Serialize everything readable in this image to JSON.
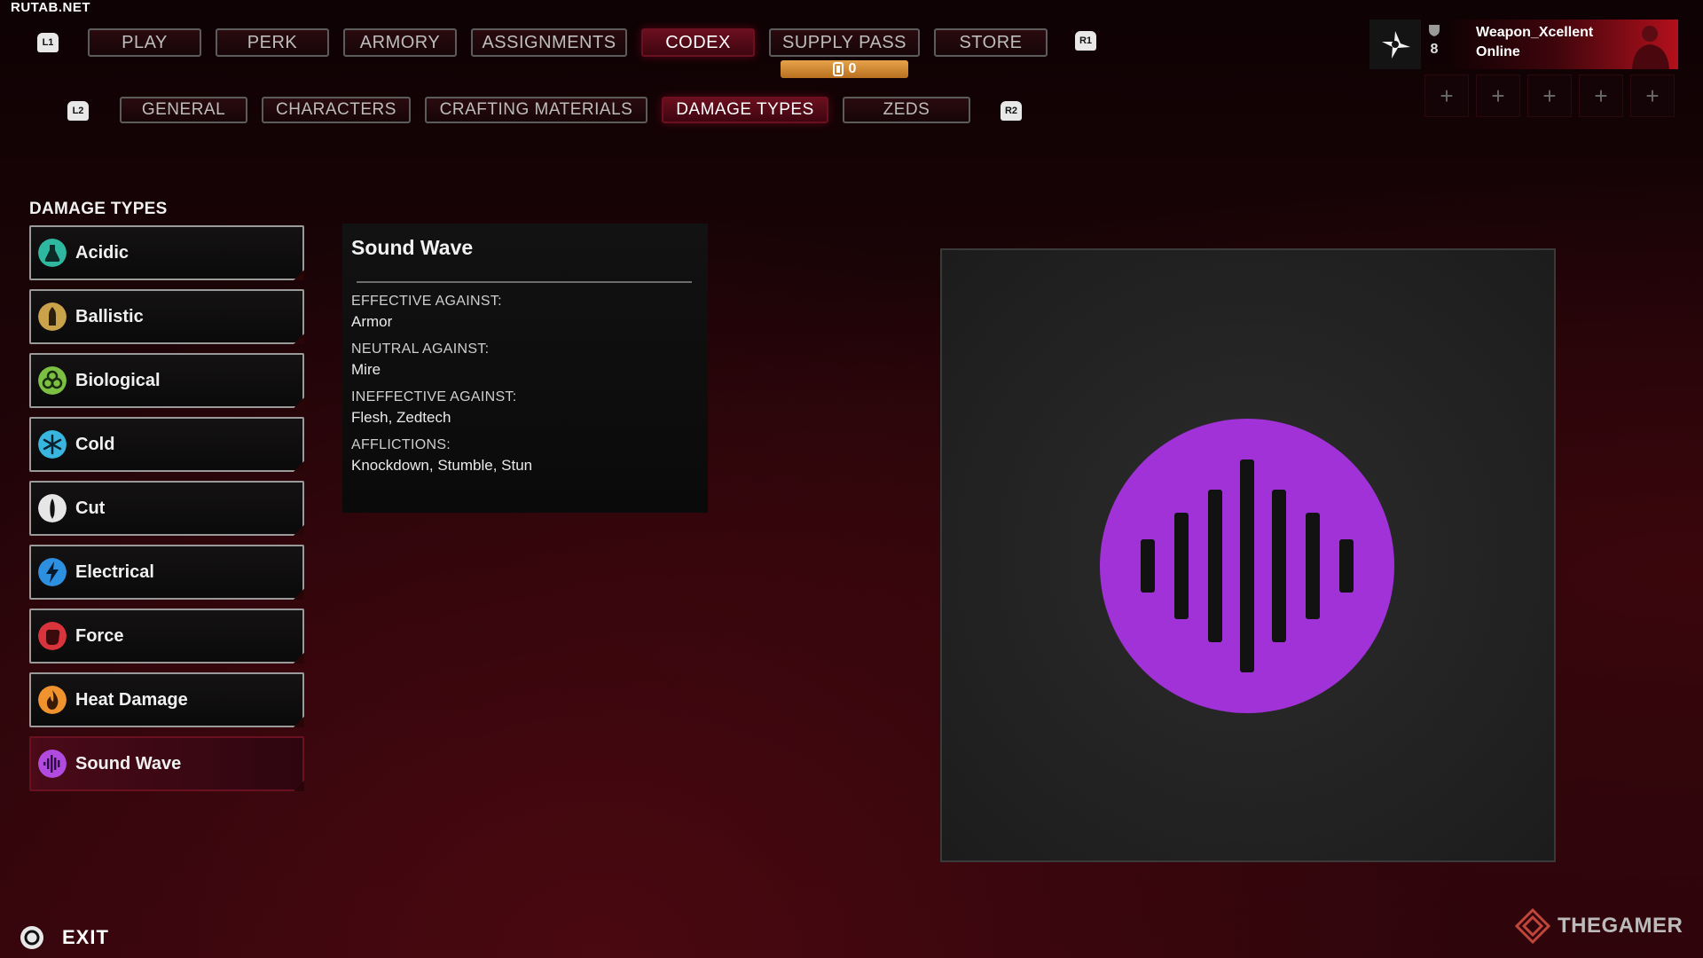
{
  "watermark": "RUTAB.NET",
  "hints": {
    "l1": "L1",
    "r1": "R1",
    "l2": "L2",
    "r2": "R2"
  },
  "main_tabs": [
    {
      "label": "PLAY",
      "active": false
    },
    {
      "label": "PERK",
      "active": false
    },
    {
      "label": "ARMORY",
      "active": false
    },
    {
      "label": "ASSIGNMENTS",
      "active": false
    },
    {
      "label": "CODEX",
      "active": true
    },
    {
      "label": "SUPPLY PASS",
      "active": false
    },
    {
      "label": "STORE",
      "active": false
    }
  ],
  "supply_pass": {
    "value": "0",
    "icon": "currency-icon"
  },
  "sub_tabs": [
    {
      "label": "GENERAL",
      "active": false
    },
    {
      "label": "CHARACTERS",
      "active": false
    },
    {
      "label": "CRAFTING MATERIALS",
      "active": false
    },
    {
      "label": "DAMAGE TYPES",
      "active": true
    },
    {
      "label": "ZEDS",
      "active": false
    }
  ],
  "profile": {
    "level": "8",
    "name": "Weapon_Xcellent",
    "status": "Online",
    "party_slot_symbol": "+"
  },
  "sidebar": {
    "title": "DAMAGE TYPES",
    "items": [
      {
        "label": "Acidic",
        "icon": "flask-icon",
        "color": "#2fb8a0",
        "selected": false
      },
      {
        "label": "Ballistic",
        "icon": "bullet-icon",
        "color": "#c9a24a",
        "selected": false
      },
      {
        "label": "Biological",
        "icon": "biohazard-icon",
        "color": "#7bc043",
        "selected": false
      },
      {
        "label": "Cold",
        "icon": "snowflake-icon",
        "color": "#39b6e0",
        "selected": false
      },
      {
        "label": "Cut",
        "icon": "blade-icon",
        "color": "#e6e6e6",
        "selected": false
      },
      {
        "label": "Electrical",
        "icon": "lightning-icon",
        "color": "#2d8fe0",
        "selected": false
      },
      {
        "label": "Force",
        "icon": "fist-icon",
        "color": "#d9343b",
        "selected": false
      },
      {
        "label": "Heat Damage",
        "icon": "flame-icon",
        "color": "#f0922e",
        "selected": false
      },
      {
        "label": "Sound Wave",
        "icon": "sound-wave-icon",
        "color": "#b14be0",
        "selected": true
      }
    ]
  },
  "detail": {
    "title": "Sound Wave",
    "effective_label": "EFFECTIVE AGAINST:",
    "effective_value": "Armor",
    "neutral_label": "NEUTRAL AGAINST:",
    "neutral_value": "Mire",
    "ineffective_label": "INEFFECTIVE AGAINST:",
    "ineffective_value": "Flesh, Zedtech",
    "afflictions_label": "AFFLICTIONS:",
    "afflictions_value": "Knockdown, Stumble, Stun"
  },
  "preview": {
    "icon": "sound-wave-icon",
    "color": "#a032d8"
  },
  "footer": {
    "exit_label": "EXIT",
    "brand": "THEGAMER"
  }
}
